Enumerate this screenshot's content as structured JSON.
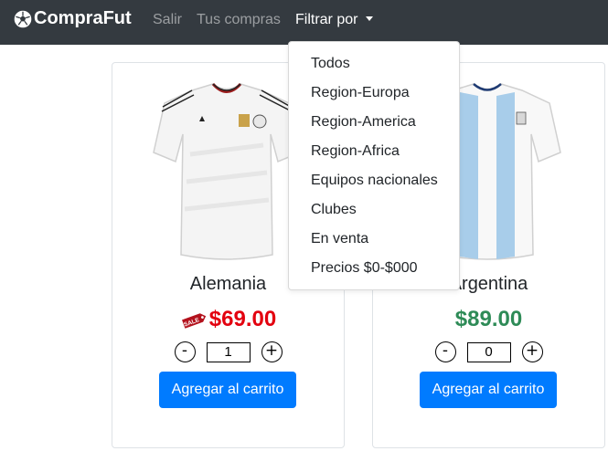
{
  "navbar": {
    "brand": "CompraFut",
    "brand_icon": "soccer-ball-icon",
    "links": {
      "logout": "Salir",
      "purchases": "Tus compras",
      "filter": "Filtrar por"
    }
  },
  "filter_menu": {
    "items": [
      "Todos",
      "Region-Europa",
      "Region-America",
      "Region-Africa",
      "Equipos nacionales",
      "Clubes",
      "En venta",
      "Precios $0-$000"
    ]
  },
  "products": [
    {
      "name": "Alemania",
      "price": "$69.00",
      "on_sale": true,
      "sale_tag_text": "SALE",
      "quantity": "1",
      "minus": "-",
      "plus": "+",
      "add_label": "Agregar al carrito",
      "image_icon": "white-jersey-image"
    },
    {
      "name": "Argentina",
      "price": "$89.00",
      "on_sale": false,
      "quantity": "0",
      "minus": "-",
      "plus": "+",
      "add_label": "Agregar al carrito",
      "image_icon": "striped-jersey-image"
    }
  ],
  "colors": {
    "navbar": "#343a40",
    "primary": "#007bff",
    "sale_price": "#e3000f",
    "regular_price": "#2e8b57"
  }
}
